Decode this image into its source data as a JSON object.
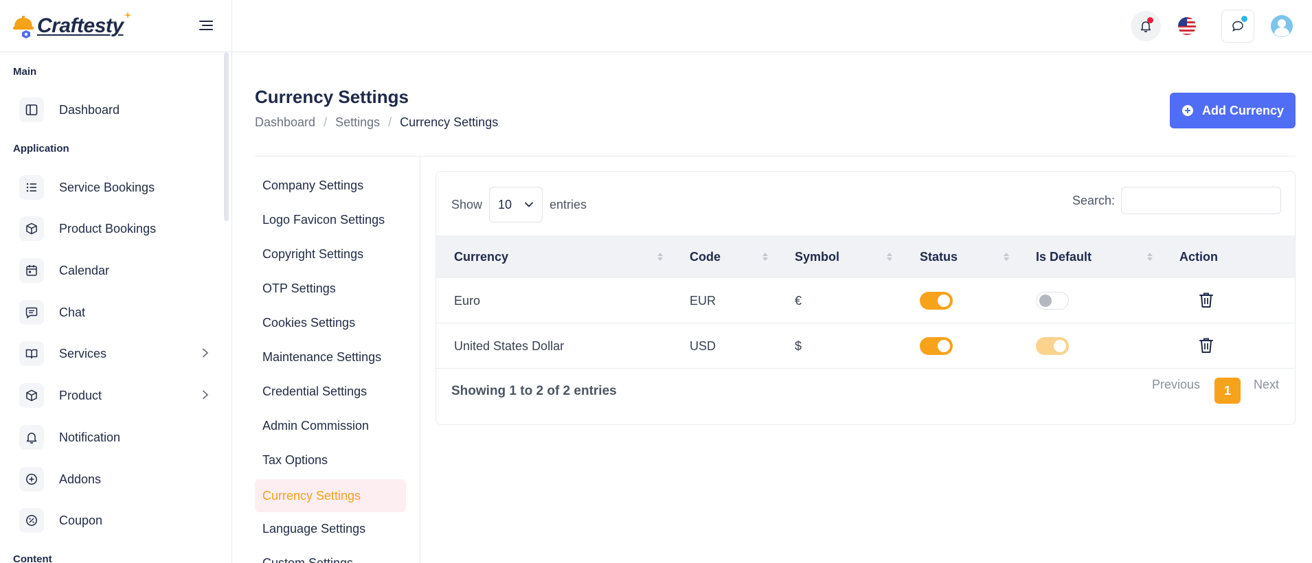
{
  "app": {
    "brand": "Craftesty"
  },
  "sidebar": {
    "sections": {
      "main": "Main",
      "application": "Application",
      "content": "Content"
    },
    "items": [
      {
        "label": "Dashboard",
        "icon": "layout-icon"
      },
      {
        "label": "Service Bookings",
        "icon": "list-icon"
      },
      {
        "label": "Product Bookings",
        "icon": "box-icon"
      },
      {
        "label": "Calendar",
        "icon": "calendar-icon"
      },
      {
        "label": "Chat",
        "icon": "chat-icon"
      },
      {
        "label": "Services",
        "icon": "book-icon"
      },
      {
        "label": "Product",
        "icon": "box-icon"
      },
      {
        "label": "Notification",
        "icon": "bell-icon"
      },
      {
        "label": "Addons",
        "icon": "plus-circle-icon"
      },
      {
        "label": "Coupon",
        "icon": "percent-icon"
      }
    ]
  },
  "header": {
    "notification_icon": "bell-icon",
    "language_icon": "us-flag-icon",
    "chat_icon": "chat-icon",
    "avatar": "user-avatar",
    "colors": {
      "notification_dot": "#e8203a",
      "chat_dot": "#2bb7e8"
    }
  },
  "page": {
    "title": "Currency Settings",
    "breadcrumb": [
      "Dashboard",
      "Settings",
      "Currency Settings"
    ],
    "add_button": "Add Currency"
  },
  "settings_menu": [
    "Company Settings",
    "Logo Favicon Settings",
    "Copyright Settings",
    "OTP Settings",
    "Cookies Settings",
    "Maintenance Settings",
    "Credential Settings",
    "Admin Commission",
    "Tax Options",
    "Currency Settings",
    "Language Settings",
    "Custom Settings"
  ],
  "settings_menu_active": "Currency Settings",
  "table": {
    "show_label": "Show",
    "entries_label": "entries",
    "page_length": "10",
    "search_label": "Search:",
    "search_value": "",
    "columns": [
      "Currency",
      "Code",
      "Symbol",
      "Status",
      "Is Default",
      "Action"
    ],
    "rows": [
      {
        "currency": "Euro",
        "code": "EUR",
        "symbol": "€",
        "status": true,
        "is_default": false
      },
      {
        "currency": "United States Dollar",
        "code": "USD",
        "symbol": "$",
        "status": true,
        "is_default": true
      }
    ],
    "info": "Showing 1 to 2 of 2 entries",
    "pagination": {
      "previous": "Previous",
      "current": "1",
      "next": "Next"
    }
  },
  "colors": {
    "accent": "#4f6df5",
    "active": "#f7a21b",
    "active_bg": "#fdeef1"
  }
}
